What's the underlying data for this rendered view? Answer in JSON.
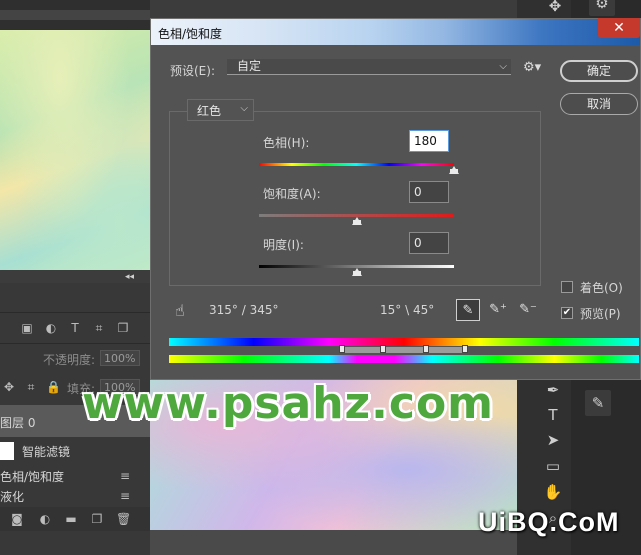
{
  "dialog": {
    "title": "色相/饱和度",
    "preset_label": "预设(E):",
    "preset_value": "自定",
    "ok_label": "确定",
    "cancel_label": "取消",
    "channel_value": "红色",
    "hue": {
      "label": "色相(H):",
      "value": "180",
      "slider_fraction": 1.0
    },
    "saturation": {
      "label": "饱和度(A):",
      "value": "0",
      "slider_fraction": 0.5
    },
    "lightness": {
      "label": "明度(I):",
      "value": "0",
      "slider_fraction": 0.5
    },
    "colorize_label": "着色(O)",
    "colorize_checked": false,
    "preview_label": "预览(P)",
    "preview_checked": true,
    "range_left": "315° / 345°",
    "range_right": "15° \\ 45°"
  },
  "left_panel": {
    "opacity_label": "不透明度:",
    "opacity_value": "100%",
    "fill_label": "填充:",
    "fill_value": "100%",
    "layer_name": "图层 0",
    "smart_filter_label": "智能滤镜",
    "filter_items": [
      "色相/饱和度",
      "液化"
    ]
  },
  "watermarks": {
    "site": "www.psahz.com",
    "brand": "UiBQ.CoM"
  },
  "icons": {
    "close": "close-icon",
    "gear": "gear-icon",
    "hand": "targeted-adjustment-hand-icon",
    "eyedropper": "eyedropper-icon",
    "eyedropper_add": "eyedropper-add-icon",
    "eyedropper_subtract": "eyedropper-subtract-icon"
  },
  "colors": {
    "dialog_bg": "#535353",
    "titlebar_accent": "#1c5aa9",
    "close_button": "#c5392d",
    "watermark_green": "#4fa83e"
  }
}
